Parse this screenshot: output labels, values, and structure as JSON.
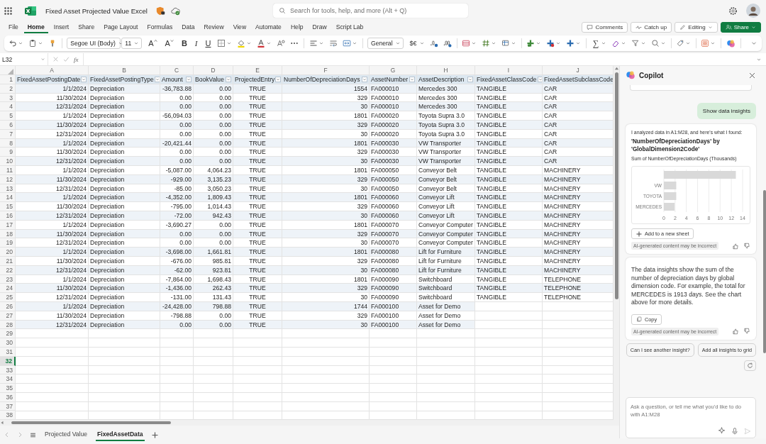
{
  "app_bar": {
    "title": "Fixed Asset Projected Value Excel",
    "search": {
      "placeholder": "Search for tools, help, and more (Alt + Q)"
    }
  },
  "menu_tabs": [
    {
      "label": "File",
      "selected": false
    },
    {
      "label": "Home",
      "selected": true
    },
    {
      "label": "Insert",
      "selected": false
    },
    {
      "label": "Share",
      "selected": false
    },
    {
      "label": "Page Layout",
      "selected": false
    },
    {
      "label": "Formulas",
      "selected": false
    },
    {
      "label": "Data",
      "selected": false
    },
    {
      "label": "Review",
      "selected": false
    },
    {
      "label": "View",
      "selected": false
    },
    {
      "label": "Automate",
      "selected": false
    },
    {
      "label": "Help",
      "selected": false
    },
    {
      "label": "Draw",
      "selected": false
    },
    {
      "label": "Script Lab",
      "selected": false
    }
  ],
  "actions": [
    {
      "label": "Comments",
      "kind": "comments"
    },
    {
      "label": "Catch up",
      "kind": "catchup"
    },
    {
      "label": "Editing",
      "kind": "editing"
    },
    {
      "label": "Share",
      "kind": "share"
    }
  ],
  "ribbon": {
    "font_name": "Segoe UI (Body)",
    "font_size": "11",
    "font_size_buttons": [
      {
        "label": "A",
        "kind": "grow"
      },
      {
        "label": "A",
        "kind": "shrink"
      }
    ],
    "style_buttons": [
      {
        "label": "B",
        "kind": "bold"
      },
      {
        "label": "I",
        "kind": "italic"
      },
      {
        "label": "U",
        "kind": "underline"
      }
    ],
    "number_format": "General",
    "currency": "$€",
    "sum": "∑"
  },
  "formula_bar": {
    "name_box": "L32",
    "function_label": "fx"
  },
  "sheet": {
    "columns": [
      "A",
      "B",
      "C",
      "D",
      "E",
      "F",
      "G",
      "H",
      "I",
      "J"
    ],
    "row_headers": [
      {
        "label": "1",
        "selected": false
      },
      {
        "label": "2",
        "selected": false
      },
      {
        "label": "3",
        "selected": false
      },
      {
        "label": "4",
        "selected": false
      },
      {
        "label": "5",
        "selected": false
      },
      {
        "label": "6",
        "selected": false
      },
      {
        "label": "7",
        "selected": false
      },
      {
        "label": "8",
        "selected": false
      },
      {
        "label": "9",
        "selected": false
      },
      {
        "label": "10",
        "selected": false
      },
      {
        "label": "11",
        "selected": false
      },
      {
        "label": "12",
        "selected": false
      },
      {
        "label": "13",
        "selected": false
      },
      {
        "label": "14",
        "selected": false
      },
      {
        "label": "15",
        "selected": false
      },
      {
        "label": "16",
        "selected": false
      },
      {
        "label": "17",
        "selected": false
      },
      {
        "label": "18",
        "selected": false
      },
      {
        "label": "19",
        "selected": false
      },
      {
        "label": "20",
        "selected": false
      },
      {
        "label": "21",
        "selected": false
      },
      {
        "label": "22",
        "selected": false
      },
      {
        "label": "23",
        "selected": false
      },
      {
        "label": "24",
        "selected": false
      },
      {
        "label": "25",
        "selected": false
      },
      {
        "label": "26",
        "selected": false
      },
      {
        "label": "27",
        "selected": false
      },
      {
        "label": "28",
        "selected": false
      },
      {
        "label": "29",
        "selected": false
      },
      {
        "label": "30",
        "selected": false
      },
      {
        "label": "31",
        "selected": false
      },
      {
        "label": "32",
        "selected": true
      },
      {
        "label": "33",
        "selected": false
      },
      {
        "label": "34",
        "selected": false
      },
      {
        "label": "35",
        "selected": false
      },
      {
        "label": "36",
        "selected": false
      },
      {
        "label": "37",
        "selected": false
      },
      {
        "label": "38",
        "selected": false
      }
    ],
    "table": {
      "headers": [
        "FixedAssetPostingDate",
        "FixedAssetPostingType",
        "Amount",
        "BookValue",
        "ProjectedEntry",
        "NumberOfDepreciationDays",
        "AssetNumber",
        "AssetDescription",
        "FixedAssetClassCode",
        "FixedAssetSubclassCode"
      ],
      "rows": [
        [
          "1/1/2024",
          "Depreciation",
          "-36,783.88",
          "0.00",
          "TRUE",
          "1554",
          "FA000010",
          "Mercedes 300",
          "TANGIBLE",
          "CAR"
        ],
        [
          "11/30/2024",
          "Depreciation",
          "0.00",
          "0.00",
          "TRUE",
          "329",
          "FA000010",
          "Mercedes 300",
          "TANGIBLE",
          "CAR"
        ],
        [
          "12/31/2024",
          "Depreciation",
          "0.00",
          "0.00",
          "TRUE",
          "30",
          "FA000010",
          "Mercedes 300",
          "TANGIBLE",
          "CAR"
        ],
        [
          "1/1/2024",
          "Depreciation",
          "-56,094.03",
          "0.00",
          "TRUE",
          "1801",
          "FA000020",
          "Toyota Supra 3.0",
          "TANGIBLE",
          "CAR"
        ],
        [
          "11/30/2024",
          "Depreciation",
          "0.00",
          "0.00",
          "TRUE",
          "329",
          "FA000020",
          "Toyota Supra 3.0",
          "TANGIBLE",
          "CAR"
        ],
        [
          "12/31/2024",
          "Depreciation",
          "0.00",
          "0.00",
          "TRUE",
          "30",
          "FA000020",
          "Toyota Supra 3.0",
          "TANGIBLE",
          "CAR"
        ],
        [
          "1/1/2024",
          "Depreciation",
          "-20,421.44",
          "0.00",
          "TRUE",
          "1801",
          "FA000030",
          "VW Transporter",
          "TANGIBLE",
          "CAR"
        ],
        [
          "11/30/2024",
          "Depreciation",
          "0.00",
          "0.00",
          "TRUE",
          "329",
          "FA000030",
          "VW Transporter",
          "TANGIBLE",
          "CAR"
        ],
        [
          "12/31/2024",
          "Depreciation",
          "0.00",
          "0.00",
          "TRUE",
          "30",
          "FA000030",
          "VW Transporter",
          "TANGIBLE",
          "CAR"
        ],
        [
          "1/1/2024",
          "Depreciation",
          "-5,087.00",
          "4,064.23",
          "TRUE",
          "1801",
          "FA000050",
          "Conveyor Belt",
          "TANGIBLE",
          "MACHINERY"
        ],
        [
          "11/30/2024",
          "Depreciation",
          "-929.00",
          "3,135.23",
          "TRUE",
          "329",
          "FA000050",
          "Conveyor Belt",
          "TANGIBLE",
          "MACHINERY"
        ],
        [
          "12/31/2024",
          "Depreciation",
          "-85.00",
          "3,050.23",
          "TRUE",
          "30",
          "FA000050",
          "Conveyor Belt",
          "TANGIBLE",
          "MACHINERY"
        ],
        [
          "1/1/2024",
          "Depreciation",
          "-4,352.00",
          "1,809.43",
          "TRUE",
          "1801",
          "FA000060",
          "Conveyor Lift",
          "TANGIBLE",
          "MACHINERY"
        ],
        [
          "11/30/2024",
          "Depreciation",
          "-795.00",
          "1,014.43",
          "TRUE",
          "329",
          "FA000060",
          "Conveyor Lift",
          "TANGIBLE",
          "MACHINERY"
        ],
        [
          "12/31/2024",
          "Depreciation",
          "-72.00",
          "942.43",
          "TRUE",
          "30",
          "FA000060",
          "Conveyor Lift",
          "TANGIBLE",
          "MACHINERY"
        ],
        [
          "1/1/2024",
          "Depreciation",
          "-3,690.27",
          "0.00",
          "TRUE",
          "1801",
          "FA000070",
          "Conveyor Computer",
          "TANGIBLE",
          "MACHINERY"
        ],
        [
          "11/30/2024",
          "Depreciation",
          "0.00",
          "0.00",
          "TRUE",
          "329",
          "FA000070",
          "Conveyor Computer",
          "TANGIBLE",
          "MACHINERY"
        ],
        [
          "12/31/2024",
          "Depreciation",
          "0.00",
          "0.00",
          "TRUE",
          "30",
          "FA000070",
          "Conveyor Computer",
          "TANGIBLE",
          "MACHINERY"
        ],
        [
          "1/1/2024",
          "Depreciation",
          "-3,698.00",
          "1,661.81",
          "TRUE",
          "1801",
          "FA000080",
          "Lift for Furniture",
          "TANGIBLE",
          "MACHINERY"
        ],
        [
          "11/30/2024",
          "Depreciation",
          "-676.00",
          "985.81",
          "TRUE",
          "329",
          "FA000080",
          "Lift for Furniture",
          "TANGIBLE",
          "MACHINERY"
        ],
        [
          "12/31/2024",
          "Depreciation",
          "-62.00",
          "923.81",
          "TRUE",
          "30",
          "FA000080",
          "Lift for Furniture",
          "TANGIBLE",
          "MACHINERY"
        ],
        [
          "1/1/2024",
          "Depreciation",
          "-7,864.00",
          "1,698.43",
          "TRUE",
          "1801",
          "FA000090",
          "Switchboard",
          "TANGIBLE",
          "TELEPHONE"
        ],
        [
          "11/30/2024",
          "Depreciation",
          "-1,436.00",
          "262.43",
          "TRUE",
          "329",
          "FA000090",
          "Switchboard",
          "TANGIBLE",
          "TELEPHONE"
        ],
        [
          "12/31/2024",
          "Depreciation",
          "-131.00",
          "131.43",
          "TRUE",
          "30",
          "FA000090",
          "Switchboard",
          "TANGIBLE",
          "TELEPHONE"
        ],
        [
          "1/1/2024",
          "Depreciation",
          "-24,428.00",
          "798.88",
          "TRUE",
          "1744",
          "FA000100",
          "Asset for Demo",
          null,
          null
        ],
        [
          "11/30/2024",
          "Depreciation",
          "-798.88",
          "0.00",
          "TRUE",
          "329",
          "FA000100",
          "Asset for Demo",
          null,
          null
        ],
        [
          "12/31/2024",
          "Depreciation",
          "0.00",
          "0.00",
          "TRUE",
          "30",
          "FA000100",
          "Asset for Demo",
          null,
          null
        ]
      ]
    }
  },
  "sheet_tabs": [
    {
      "label": "Projected Value",
      "selected": false
    },
    {
      "label": "FixedAssetData",
      "selected": true
    }
  ],
  "copilot": {
    "title": "Copilot",
    "messages": [
      {
        "kind": "user",
        "text": "Show data insights"
      },
      {
        "kind": "insight",
        "intro": "I analyzed data in A1:M28, and here's what I found:",
        "heading": "'NumberOfDepreciationDays' by 'GlobalDimension2Code'",
        "subtitle": "Sum of NumberOfDepreciationDays (Thousands)",
        "chart_data": {
          "type": "bar",
          "orientation": "horizontal",
          "categories": [
            null,
            "VW",
            "TOYOTA",
            "MERCEDES"
          ],
          "values": [
            12.8,
            2.2,
            2.2,
            1.9
          ],
          "xlim": [
            0,
            14
          ],
          "xticks": [
            0,
            2,
            4,
            6,
            8,
            10,
            12,
            14
          ],
          "grid": true
        },
        "action": "Add to a new sheet",
        "disclaimer": "AI-generated content may be incorrect"
      },
      {
        "kind": "answer",
        "text": "The data insights show the sum of the number of depreciation days by global dimension code. For example, the total for MERCEDES is 1913 days. See the chart above for more details.",
        "action": "Copy",
        "disclaimer": "AI-generated content may be incorrect"
      }
    ],
    "suggestions": [
      "Can I see another insight?",
      "Add all insights to grid"
    ],
    "input": {
      "placeholder": "Ask a question, or tell me what you'd like to do with A1:M28",
      "send_disabled": true
    }
  }
}
